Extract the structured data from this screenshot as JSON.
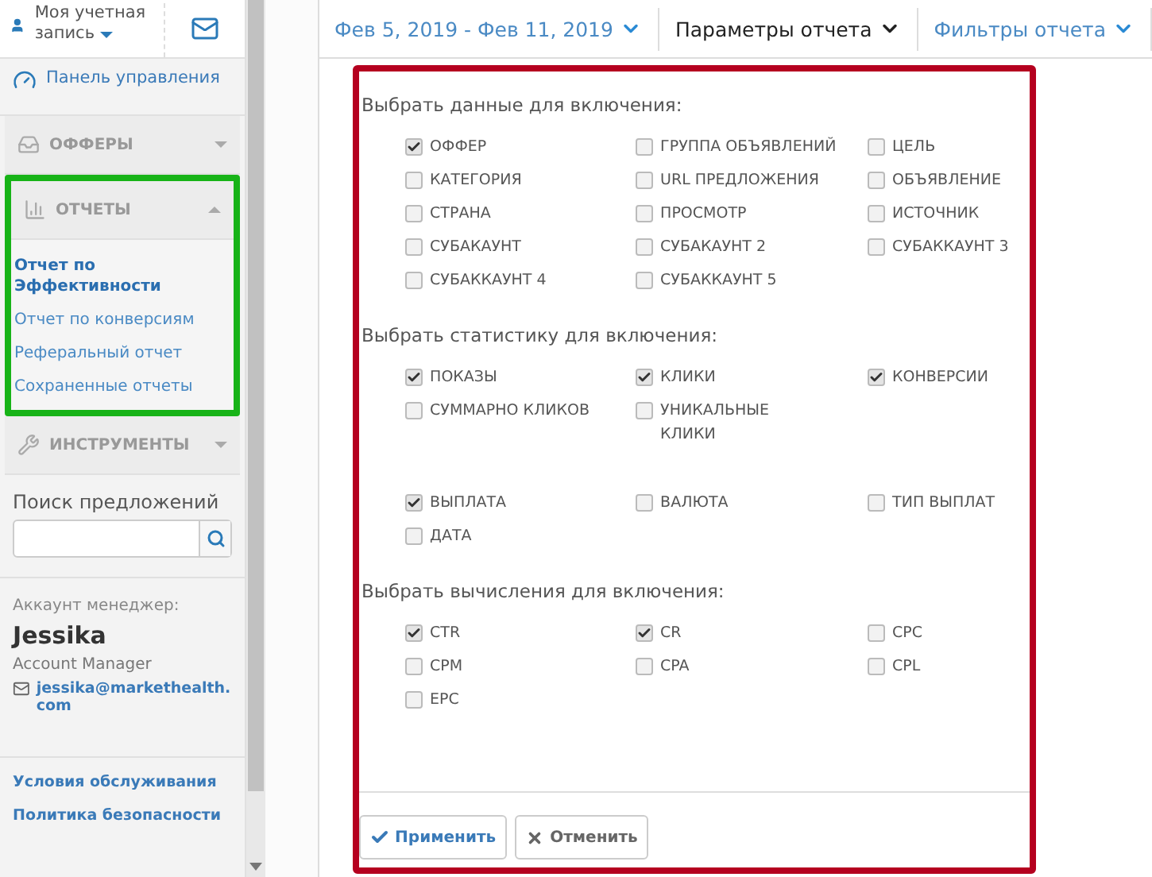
{
  "sidebar": {
    "account": {
      "label": "Моя учетная запись"
    },
    "nav": [
      {
        "kind": "link",
        "label": "Панель управления"
      },
      {
        "kind": "section",
        "label": "ОФФЕРЫ",
        "expanded": false
      },
      {
        "kind": "section",
        "label": "ОТЧЕТЫ",
        "expanded": true,
        "children": [
          {
            "label": "Отчет по Эффективности",
            "selected": true
          },
          {
            "label": "Отчет по конверсиям",
            "selected": false
          },
          {
            "label": "Реферальный отчет",
            "selected": false
          },
          {
            "label": "Сохраненные отчеты",
            "selected": false
          }
        ]
      },
      {
        "kind": "section",
        "label": "ИНСТРУМЕНТЫ",
        "expanded": false
      }
    ],
    "search": {
      "label": "Поиск предложений"
    },
    "manager": {
      "heading": "Аккаунт менеджер:",
      "name": "Jessika",
      "role": "Account Manager",
      "email": "jessika@markethealth.com"
    },
    "footer_links": [
      "Условия обслуживания",
      "Политика безопасности"
    ]
  },
  "toolbar": [
    {
      "label": "Фев 5, 2019 - Фев 11, 2019",
      "selected": false
    },
    {
      "label": "Параметры отчета",
      "selected": true
    },
    {
      "label": "Фильтры отчета",
      "selected": false
    }
  ],
  "groups": [
    {
      "title": "Выбрать данные для включения:",
      "items": [
        {
          "label": "ОФФЕР",
          "checked": true
        },
        {
          "label": "ГРУППА ОБЪЯВЛЕНИЙ",
          "checked": false
        },
        {
          "label": "ЦЕЛЬ",
          "checked": false
        },
        {
          "label": "КАТЕГОРИЯ",
          "checked": false
        },
        {
          "label": "URL ПРЕДЛОЖЕНИЯ",
          "checked": false
        },
        {
          "label": "ОБЪЯВЛЕНИЕ",
          "checked": false
        },
        {
          "label": "СТРАНА",
          "checked": false
        },
        {
          "label": "ПРОСМОТР",
          "checked": false
        },
        {
          "label": "ИСТОЧНИК",
          "checked": false
        },
        {
          "label": "СУБАКАУНТ",
          "checked": false
        },
        {
          "label": "СУБАКАУНТ 2",
          "checked": false
        },
        {
          "label": "СУБАККАУНТ 3",
          "checked": false
        },
        {
          "label": "СУБАККАУНТ 4",
          "checked": false
        },
        {
          "label": "СУБАККАУНТ 5",
          "checked": false
        }
      ]
    },
    {
      "title": "Выбрать статистику для включения:",
      "items": [
        {
          "label": "ПОКАЗЫ",
          "checked": true
        },
        {
          "label": "КЛИКИ",
          "checked": true
        },
        {
          "label": "КОНВЕРСИИ",
          "checked": true
        },
        {
          "label": "СУММАРНО КЛИКОВ",
          "checked": false
        },
        {
          "label": "УНИКАЛЬНЫЕ КЛИКИ",
          "checked": false
        },
        {
          "label": "ВЫПЛАТА",
          "checked": true
        },
        {
          "label": "ВАЛЮТА",
          "checked": false
        },
        {
          "label": "ТИП ВЫПЛАТ",
          "checked": false
        },
        {
          "label": "ДАТА",
          "checked": false
        }
      ]
    },
    {
      "title": "Выбрать вычисления для включения:",
      "items": [
        {
          "label": "CTR",
          "checked": true
        },
        {
          "label": "CR",
          "checked": true
        },
        {
          "label": "CPC",
          "checked": false
        },
        {
          "label": "CPM",
          "checked": false
        },
        {
          "label": "CPA",
          "checked": false
        },
        {
          "label": "CPL",
          "checked": false
        },
        {
          "label": "EPC",
          "checked": false
        }
      ]
    }
  ],
  "buttons": [
    {
      "kind": "apply",
      "label": "Применить"
    },
    {
      "kind": "cancel",
      "label": "Отменить"
    }
  ]
}
